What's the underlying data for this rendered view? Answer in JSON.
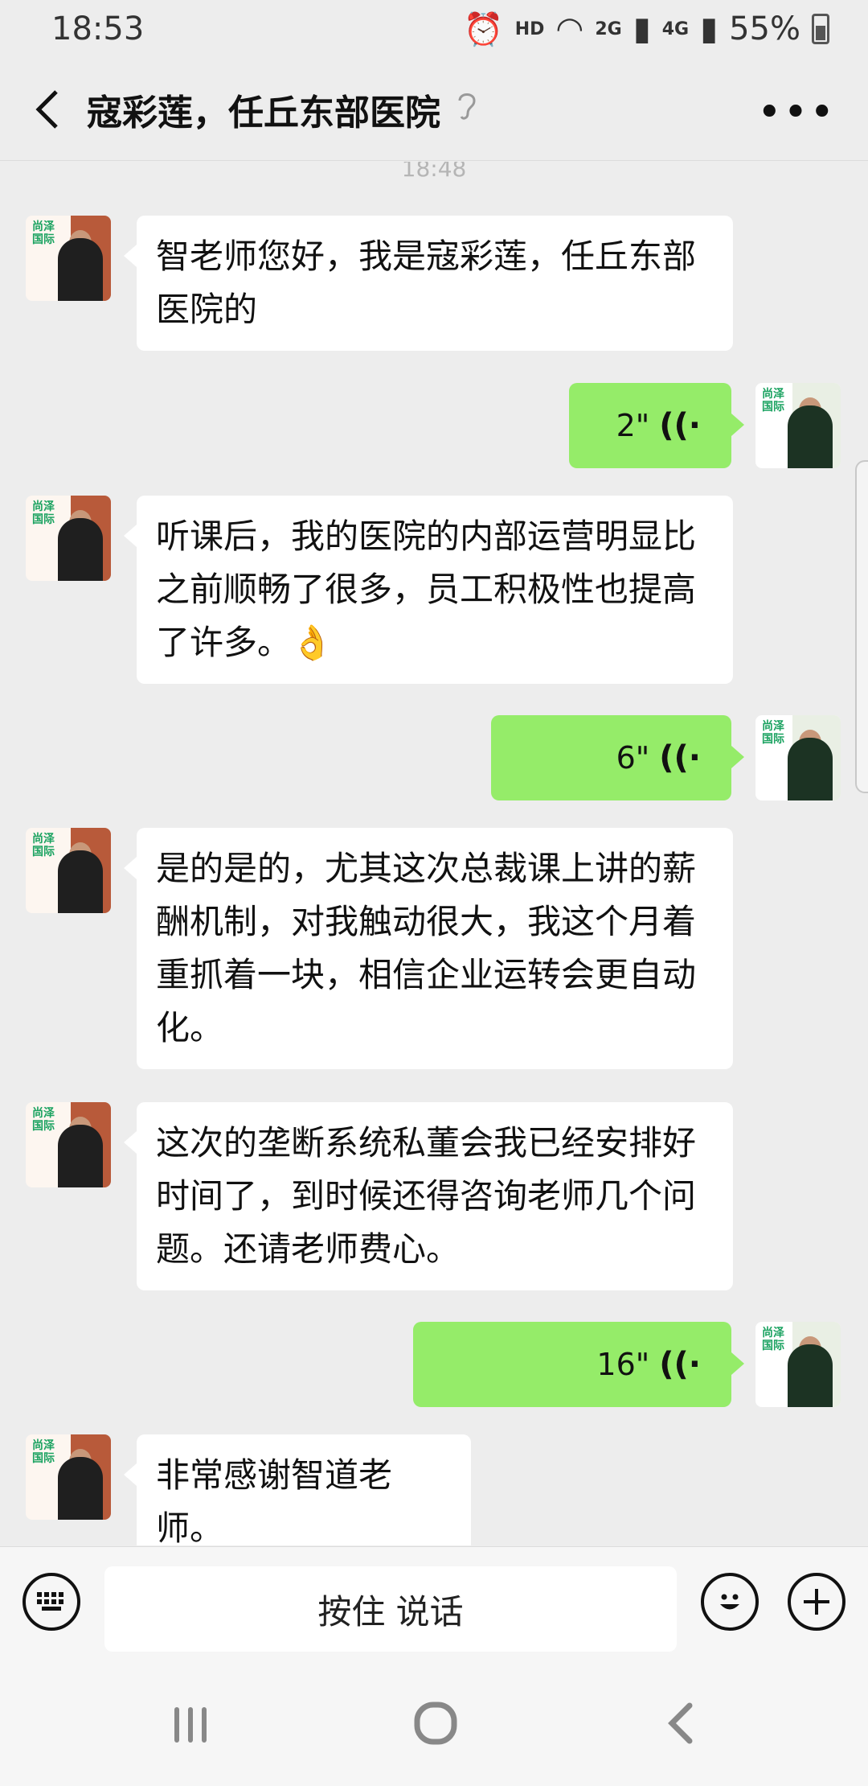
{
  "status_bar": {
    "time": "18:53",
    "hd": "HD",
    "net_2g": "2G",
    "net_4g": "4G",
    "battery_percent": "55%"
  },
  "header": {
    "title": "寇彩莲，任丘东部医院"
  },
  "chat": {
    "timestamp": "18:48",
    "messages": [
      {
        "side": "left",
        "type": "text",
        "text_lines": [
          "智老师您好，我是寇彩莲，任丘东部",
          "医院的"
        ]
      },
      {
        "side": "right",
        "type": "voice",
        "duration": "2\""
      },
      {
        "side": "left",
        "type": "text",
        "text_lines": [
          "听课后，我的医院的内部运营明显比",
          "之前顺畅了很多，员工积极性也提高",
          "了许多。👌"
        ]
      },
      {
        "side": "right",
        "type": "voice",
        "duration": "6\""
      },
      {
        "side": "left",
        "type": "text",
        "text_lines": [
          "是的是的，尤其这次总裁课上讲的薪",
          "酬机制，对我触动很大，我这个月着",
          "重抓着一块，相信企业运转会更自动",
          "化。"
        ]
      },
      {
        "side": "left",
        "type": "text",
        "text_lines": [
          "这次的垄断系统私董会我已经安排好",
          "时间了，到时候还得咨询老师几个问",
          "题。还请老师费心。"
        ]
      },
      {
        "side": "right",
        "type": "voice",
        "duration": "16\""
      },
      {
        "side": "left",
        "type": "text",
        "text_lines": [
          "非常感谢智道老师。"
        ]
      }
    ],
    "avatar_logo_text": "尚泽国际"
  },
  "input_bar": {
    "hold_to_talk": "按住 说话"
  },
  "colors": {
    "background": "#ededed",
    "own_bubble": "#95ec69",
    "other_bubble": "#ffffff"
  },
  "icons": {
    "back": "chevron-left-icon",
    "listen": "ear-icon",
    "more": "more-dots-icon",
    "keyboard": "keyboard-icon",
    "emoji": "smiley-icon",
    "plus": "plus-icon",
    "voice": "voice-wave-icon"
  }
}
